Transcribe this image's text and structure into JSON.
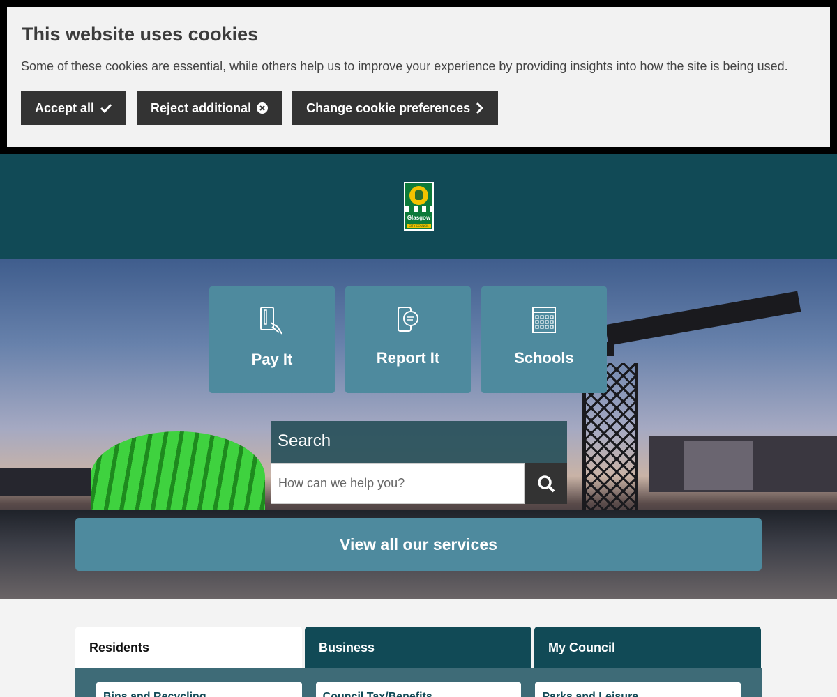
{
  "cookie_banner": {
    "title": "This website uses cookies",
    "text": "Some of these cookies are essential, while others help us to improve your experience by providing insights into how the site is being used.",
    "accept_label": "Accept all",
    "reject_label": "Reject additional",
    "preferences_label": "Change cookie preferences"
  },
  "header": {
    "logo_name": "Glasgow",
    "logo_sub": "CITY COUNCIL"
  },
  "quick_links": [
    {
      "label": "Pay It",
      "icon": "card-payment-icon"
    },
    {
      "label": "Report It",
      "icon": "phone-chat-icon"
    },
    {
      "label": "Schools",
      "icon": "calendar-grid-icon"
    }
  ],
  "search": {
    "heading": "Search",
    "placeholder": "How can we help you?"
  },
  "view_all_label": "View all our services",
  "tabs": [
    {
      "label": "Residents",
      "active": true
    },
    {
      "label": "Business",
      "active": false
    },
    {
      "label": "My Council",
      "active": false
    }
  ],
  "service_cards": [
    "Bins and Recycling",
    "Council Tax/Benefits",
    "Parks and Leisure"
  ],
  "colors": {
    "header_bg": "#114a56",
    "tile_bg": "#4e8a9e",
    "button_dark": "#333333",
    "banner_bg": "#f2f2f2"
  }
}
